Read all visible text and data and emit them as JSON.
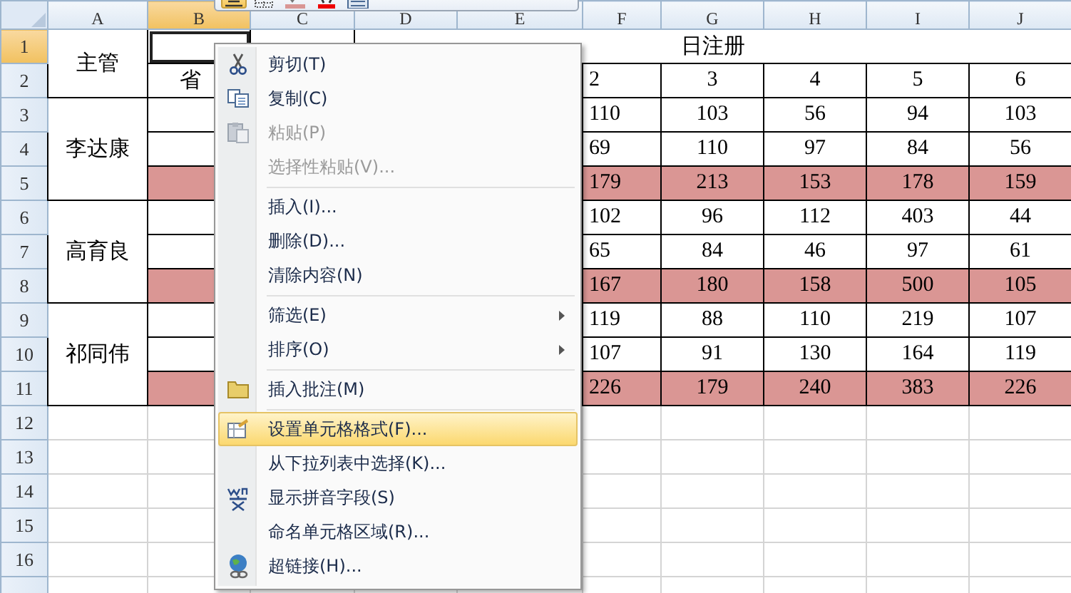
{
  "column_headers": [
    {
      "label": "A",
      "selected": false
    },
    {
      "label": "B",
      "selected": true
    },
    {
      "label": "C",
      "selected": false
    },
    {
      "label": "D",
      "selected": false
    },
    {
      "label": "E",
      "selected": false
    },
    {
      "label": "F",
      "selected": false
    },
    {
      "label": "G",
      "selected": false
    },
    {
      "label": "H",
      "selected": false
    },
    {
      "label": "I",
      "selected": false
    },
    {
      "label": "J",
      "selected": false
    }
  ],
  "row_headers": [
    {
      "label": "1",
      "selected": true
    },
    {
      "label": "2",
      "selected": false
    },
    {
      "label": "3",
      "selected": false
    },
    {
      "label": "4",
      "selected": false
    },
    {
      "label": "5",
      "selected": false
    },
    {
      "label": "6",
      "selected": false
    },
    {
      "label": "7",
      "selected": false
    },
    {
      "label": "8",
      "selected": false
    },
    {
      "label": "9",
      "selected": false
    },
    {
      "label": "10",
      "selected": false
    },
    {
      "label": "11",
      "selected": false
    },
    {
      "label": "12",
      "selected": false
    },
    {
      "label": "13",
      "selected": false
    },
    {
      "label": "14",
      "selected": false
    },
    {
      "label": "15",
      "selected": false
    },
    {
      "label": "16",
      "selected": false
    }
  ],
  "header": {
    "supervisor_label": "主管",
    "province_label": "省",
    "title": "日注册",
    "days": [
      "2",
      "3",
      "4",
      "5",
      "6"
    ]
  },
  "groups": [
    {
      "supervisor": "李达康",
      "rows": [
        {
          "highlighted": false,
          "values": [
            "110",
            "103",
            "56",
            "94",
            "103"
          ]
        },
        {
          "highlighted": false,
          "values": [
            "69",
            "110",
            "97",
            "84",
            "56"
          ]
        },
        {
          "highlighted": true,
          "values": [
            "179",
            "213",
            "153",
            "178",
            "159"
          ]
        }
      ]
    },
    {
      "supervisor": "高育良",
      "rows": [
        {
          "highlighted": false,
          "values": [
            "102",
            "96",
            "112",
            "403",
            "44"
          ]
        },
        {
          "highlighted": false,
          "values": [
            "65",
            "84",
            "46",
            "97",
            "61"
          ]
        },
        {
          "highlighted": true,
          "values": [
            "167",
            "180",
            "158",
            "500",
            "105"
          ]
        }
      ]
    },
    {
      "supervisor": "祁同伟",
      "rows": [
        {
          "highlighted": false,
          "values": [
            "119",
            "88",
            "110",
            "219",
            "107"
          ]
        },
        {
          "highlighted": false,
          "values": [
            "107",
            "91",
            "130",
            "164",
            "119"
          ]
        },
        {
          "highlighted": true,
          "values": [
            "226",
            "179",
            "240",
            "383",
            "226"
          ]
        }
      ]
    }
  ],
  "mini_toolbar": [
    {
      "kind": "align",
      "selected": true
    },
    {
      "kind": "border"
    },
    {
      "kind": "fill"
    },
    {
      "kind": "font-color"
    },
    {
      "kind": "format"
    }
  ],
  "context_menu": [
    [
      {
        "kind": "cut",
        "label": "剪切(T)",
        "disabled": false,
        "highlighted": false,
        "submenu": false
      },
      {
        "kind": "copy",
        "label": "复制(C)",
        "disabled": false,
        "highlighted": false,
        "submenu": false
      },
      {
        "kind": "paste",
        "label": "粘贴(P)",
        "disabled": true,
        "highlighted": false,
        "submenu": false
      },
      {
        "kind": "plain",
        "label": "选择性粘贴(V)...",
        "disabled": true,
        "highlighted": false,
        "submenu": false
      }
    ],
    [
      {
        "kind": "plain",
        "label": "插入(I)...",
        "disabled": false,
        "highlighted": false,
        "submenu": false
      },
      {
        "kind": "plain",
        "label": "删除(D)...",
        "disabled": false,
        "highlighted": false,
        "submenu": false
      },
      {
        "kind": "plain",
        "label": "清除内容(N)",
        "disabled": false,
        "highlighted": false,
        "submenu": false
      }
    ],
    [
      {
        "kind": "plain",
        "label": "筛选(E)",
        "disabled": false,
        "highlighted": false,
        "submenu": true
      },
      {
        "kind": "plain",
        "label": "排序(O)",
        "disabled": false,
        "highlighted": false,
        "submenu": true
      }
    ],
    [
      {
        "kind": "comment",
        "label": "插入批注(M)",
        "disabled": false,
        "highlighted": false,
        "submenu": false
      }
    ],
    [
      {
        "kind": "format",
        "label": "设置单元格格式(F)...",
        "disabled": false,
        "highlighted": true,
        "submenu": false
      },
      {
        "kind": "plain",
        "label": "从下拉列表中选择(K)...",
        "disabled": false,
        "highlighted": false,
        "submenu": false
      },
      {
        "kind": "phonetic",
        "label": "显示拼音字段(S)",
        "disabled": false,
        "highlighted": false,
        "submenu": false
      },
      {
        "kind": "plain",
        "label": "命名单元格区域(R)...",
        "disabled": false,
        "highlighted": false,
        "submenu": false
      },
      {
        "kind": "link",
        "label": "超链接(H)...",
        "disabled": false,
        "highlighted": false,
        "submenu": false
      }
    ]
  ]
}
